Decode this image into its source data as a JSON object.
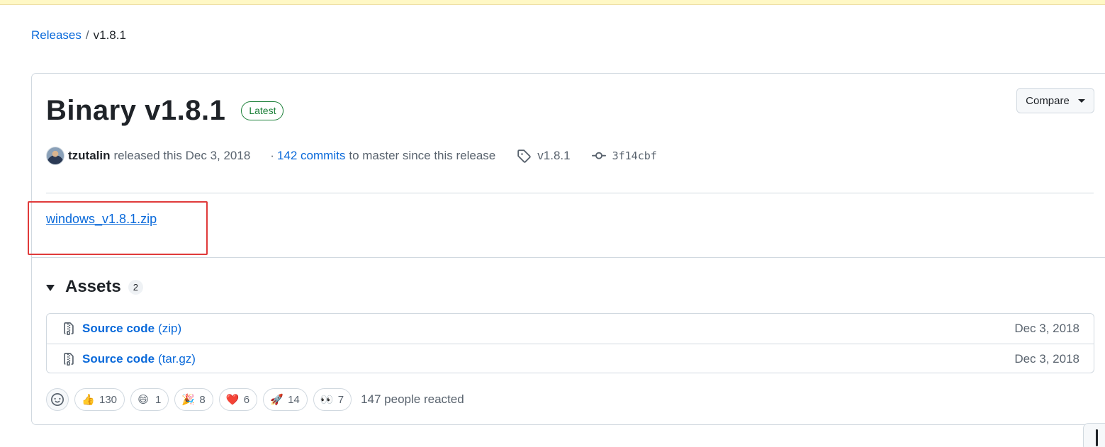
{
  "breadcrumb": {
    "releases_label": "Releases",
    "separator": "/",
    "current": "v1.8.1"
  },
  "release": {
    "title": "Binary v1.8.1",
    "badge": "Latest",
    "compare_label": "Compare",
    "author": "tzutalin",
    "released_text": "released this Dec 3, 2018",
    "commits_dot": "·",
    "commits_link": "142 commits",
    "commits_tail": "to master since this release",
    "tag": "v1.8.1",
    "commit_sha": "3f14cbf",
    "body_link": "windows_v1.8.1.zip"
  },
  "assets": {
    "title": "Assets",
    "count": "2",
    "items": [
      {
        "name": "Source code",
        "ext": "(zip)",
        "date": "Dec 3, 2018"
      },
      {
        "name": "Source code",
        "ext": "(tar.gz)",
        "date": "Dec 3, 2018"
      }
    ]
  },
  "reactions": {
    "items": [
      {
        "emoji": "👍",
        "count": "130",
        "icon": "thumbs-up-icon"
      },
      {
        "emoji": "😄",
        "count": "1",
        "icon": "laugh-icon"
      },
      {
        "emoji": "🎉",
        "count": "8",
        "icon": "hooray-icon"
      },
      {
        "emoji": "❤️",
        "count": "6",
        "icon": "heart-icon"
      },
      {
        "emoji": "🚀",
        "count": "14",
        "icon": "rocket-icon"
      },
      {
        "emoji": "👀",
        "count": "7",
        "icon": "eyes-icon"
      }
    ],
    "summary": "147 people reacted"
  },
  "colors": {
    "link": "#0969da",
    "latest_badge": "#1a7f37",
    "highlight_box": "#e03a3a",
    "banner": "#fff8c5"
  }
}
